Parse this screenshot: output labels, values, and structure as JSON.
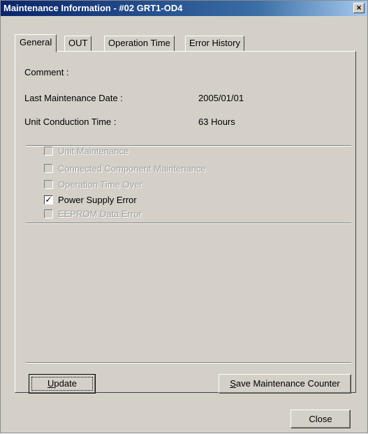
{
  "window": {
    "title": "Maintenance Information - #02 GRT1-OD4",
    "close_glyph": "×"
  },
  "tabs": [
    {
      "label": "General",
      "active": true
    },
    {
      "label": "OUT",
      "active": false
    },
    {
      "label": "Operation Time",
      "active": false
    },
    {
      "label": "Error History",
      "active": false
    }
  ],
  "info": {
    "comment_label": "Comment :",
    "comment_value": "",
    "last_maint_label": "Last Maintenance Date :",
    "last_maint_value": "2005/01/01",
    "conduction_label": "Unit Conduction Time :",
    "conduction_value": "63 Hours"
  },
  "checks": [
    {
      "label": "Unit Maintenance",
      "checked": false,
      "enabled": false
    },
    {
      "label": "Connected Component Maintenance",
      "checked": false,
      "enabled": false
    },
    {
      "label": "Operation Time Over",
      "checked": false,
      "enabled": false
    },
    {
      "label": "Power Supply Error",
      "checked": true,
      "enabled": true
    },
    {
      "label": "EEPROM Data Error",
      "checked": false,
      "enabled": false
    }
  ],
  "buttons": {
    "update_mnemonic": "U",
    "update_rest": "pdate",
    "save_mnemonic": "S",
    "save_rest": "ave Maintenance Counter",
    "close": "Close"
  },
  "checkmark_glyph": "✓"
}
